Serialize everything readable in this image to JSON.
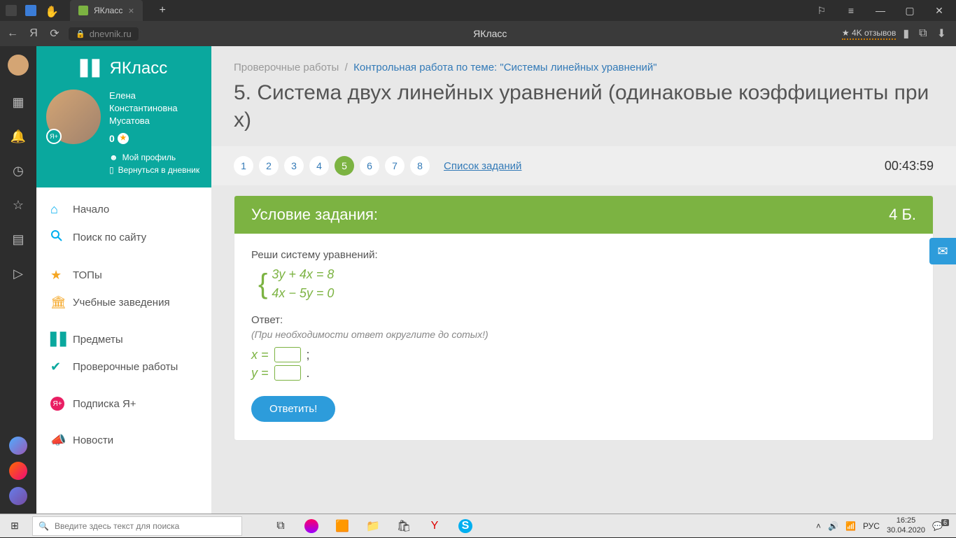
{
  "browser": {
    "tab_title": "ЯКласс",
    "url_host": "dnevnik.ru",
    "page_title_center": "ЯКласс",
    "reviews": "★ 4K отзывов"
  },
  "sidebar": {
    "logo": "ЯКласс",
    "user_name_line1": "Елена",
    "user_name_line2": "Константиновна",
    "user_name_line3": "Мусатова",
    "score": "0",
    "my_profile": "Мой профиль",
    "back_to_diary": "Вернуться в дневник",
    "items": [
      {
        "label": "Начало"
      },
      {
        "label": "Поиск по сайту"
      },
      {
        "label": "ТОПы"
      },
      {
        "label": "Учебные заведения"
      },
      {
        "label": "Предметы"
      },
      {
        "label": "Проверочные работы"
      },
      {
        "label": "Подписка Я+"
      },
      {
        "label": "Новости"
      }
    ]
  },
  "main": {
    "breadcrumb_root": "Проверочные работы",
    "breadcrumb_link": "Контрольная работа по теме: \"Системы линейных уравнений\"",
    "heading": "5. Система двух линейных уравнений (одинаковые коэффициенты при x)",
    "tasks": [
      "1",
      "2",
      "3",
      "4",
      "5",
      "6",
      "7",
      "8"
    ],
    "active_task": "5",
    "task_list_label": "Список заданий",
    "timer": "00:43:59",
    "card_title": "Условие задания:",
    "points": "4 Б.",
    "prompt": "Реши систему уравнений:",
    "eq1": "3y + 4x = 8",
    "eq2": "4x − 5y = 0",
    "answer_label": "Ответ:",
    "hint": "(При необходимости ответ округлите до сотых!)",
    "var_x": "x =",
    "var_y": "y =",
    "semicolon": ";",
    "period": ".",
    "submit": "Ответить!"
  },
  "taskbar": {
    "search_placeholder": "Введите здесь текст для поиска",
    "lang": "РУС",
    "time": "16:25",
    "date": "30.04.2020",
    "notif_count": "6"
  }
}
